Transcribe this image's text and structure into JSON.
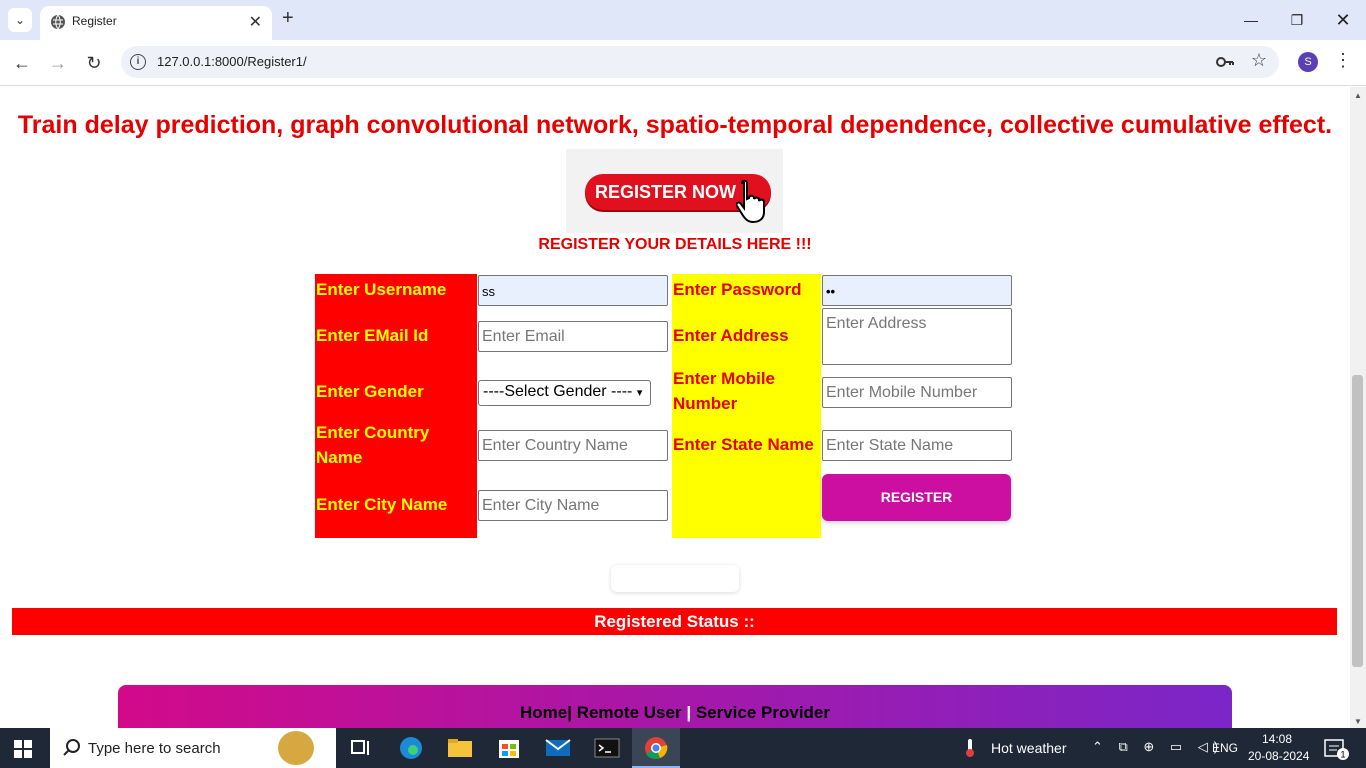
{
  "browser": {
    "tab_title": "Register",
    "url": "127.0.0.1:8000/Register1/",
    "profile_initial": "S"
  },
  "page": {
    "heading": "Train delay prediction, graph convolutional network, spatio-temporal dependence, collective cumulative effect.",
    "banner_text": "REGISTER NOW",
    "subheading": "REGISTER YOUR DETAILS HERE !!!",
    "form": {
      "labels": {
        "username": "Enter Username",
        "email": "Enter EMail Id",
        "gender": "Enter Gender",
        "country": "Enter Country Name",
        "city": "Enter City Name",
        "password": "Enter Password",
        "address": "Enter Address",
        "mobile": "Enter Mobile Number",
        "state": "Enter State Name"
      },
      "values": {
        "username": "ss",
        "password": "••"
      },
      "placeholders": {
        "email": "Enter Email",
        "country": "Enter Country Name",
        "city": "Enter City Name",
        "address": "Enter Address",
        "mobile": "Enter Mobile Number",
        "state": "Enter State Name"
      },
      "gender_selected": "----Select Gender ----",
      "submit_label": "REGISTER"
    },
    "status_text": "Registered Status ::",
    "footer": {
      "home": "Home",
      "remote_user": "Remote User",
      "service_provider": "Service Provider",
      "sep1": "|",
      "sep2": "|"
    }
  },
  "taskbar": {
    "search_placeholder": "Type here to search",
    "weather": "Hot weather",
    "language": "ENG",
    "time": "14:08",
    "date": "20-08-2024",
    "notifications": "1"
  },
  "colors": {
    "heading": "#e60000",
    "label_col_red": "#ff0000",
    "label_col_yellow": "#ffff00",
    "register_button": "#cc0fa0",
    "footer_gradient_start": "#d20a8a",
    "footer_gradient_end": "#7b26c8"
  }
}
